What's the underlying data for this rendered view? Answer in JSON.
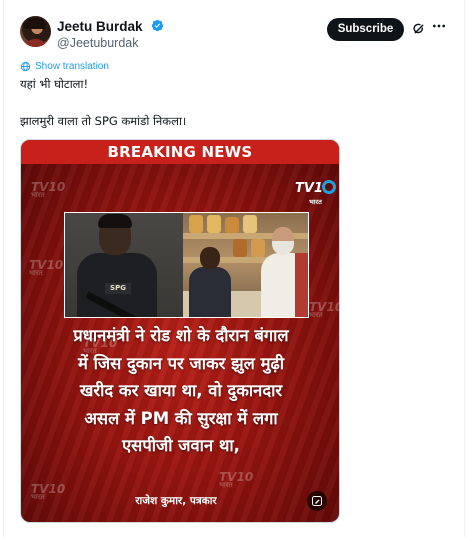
{
  "author": {
    "display_name": "Jeetu Burdak",
    "handle": "@Jeetuburdak",
    "verified": true
  },
  "actions": {
    "subscribe_label": "Subscribe",
    "grok_icon": "grok-icon",
    "more_icon": "more-icon"
  },
  "translate": {
    "label": "Show translation",
    "icon": "globe-icon"
  },
  "tweet": {
    "line1": "यहां भी घोटाला!",
    "line2": "झालमुरी वाला तो SPG कमांडो निकला।"
  },
  "media": {
    "banner": "BREAKING NEWS",
    "channel_logo": "TV10",
    "channel_sub": "भारत",
    "patch_text": "SPG",
    "headline_lines": [
      "प्रधानमंत्री ने रोड शो के दौरान बंगाल",
      "में जिस दुकान पर जाकर झुल मुढ़ी",
      "खरीद कर खाया था, वो दुकानदार",
      "असल में PM की सुरक्षा में लगा",
      "एसपीजी जवान था,"
    ],
    "reporter": "राजेश कुमार, पत्रकार",
    "edit_icon": "image-edit-icon"
  },
  "colors": {
    "accent": "#1d9bf0",
    "banner_red": "#c8201a",
    "text": "#0f1419",
    "muted": "#536471"
  }
}
